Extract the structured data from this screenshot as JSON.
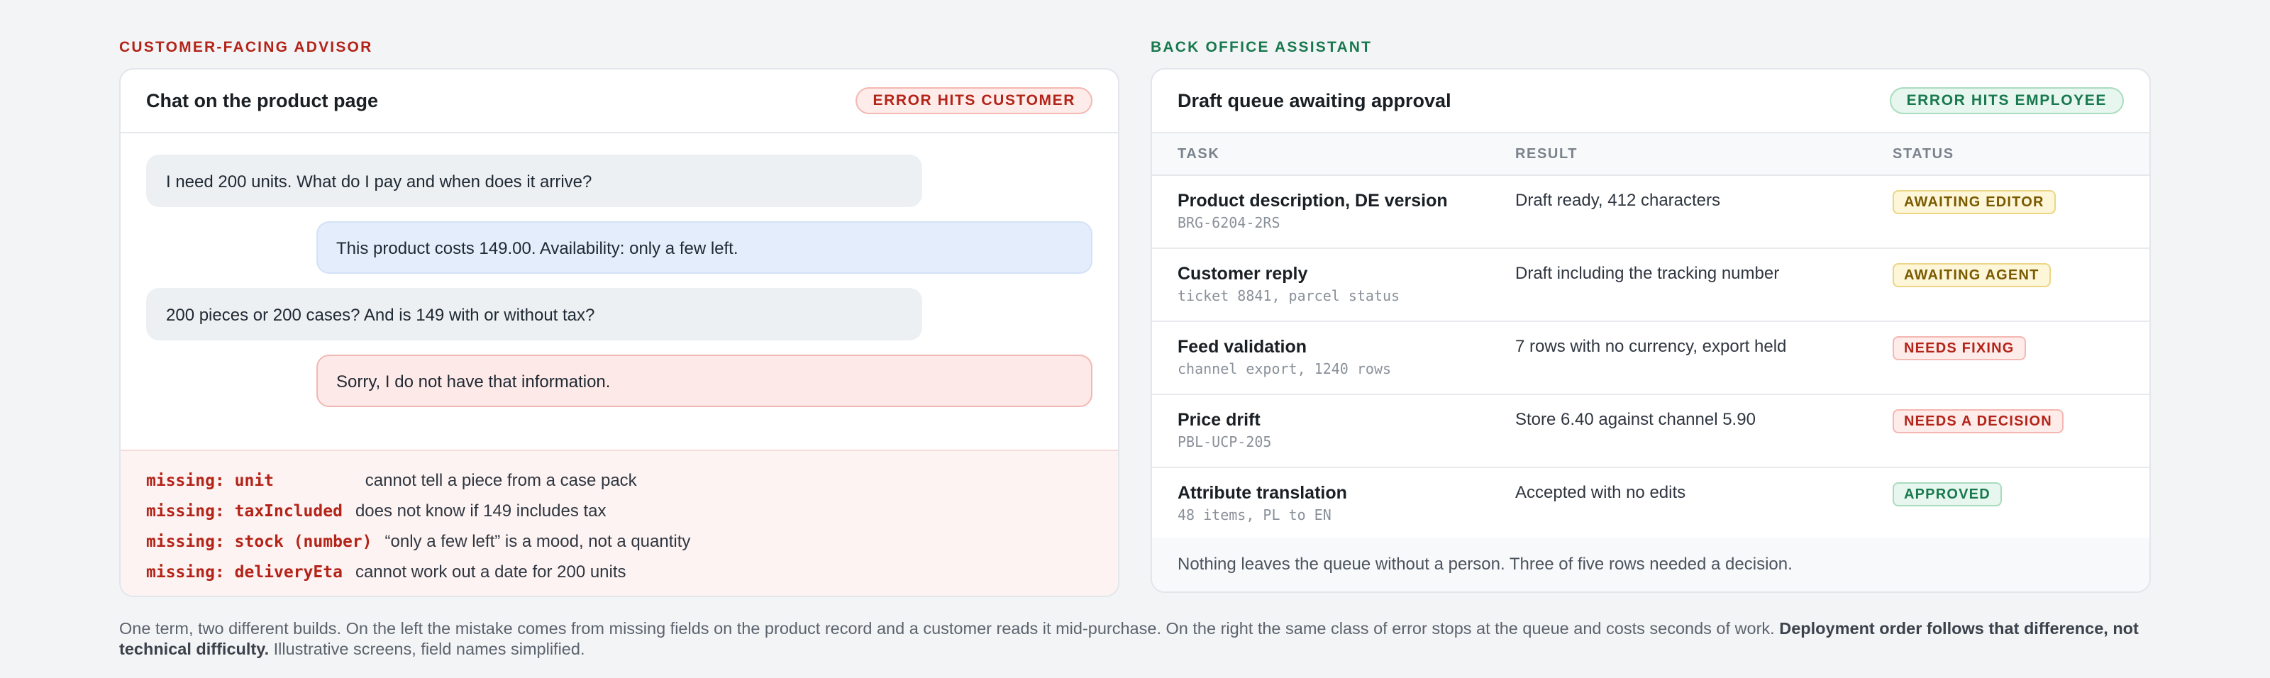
{
  "left": {
    "section_label": "CUSTOMER-FACING ADVISOR",
    "card_title": "Chat on the product page",
    "badge": "ERROR HITS CUSTOMER",
    "messages": [
      {
        "role": "user",
        "text": "I need 200 units. What do I pay and when does it arrive?"
      },
      {
        "role": "bot",
        "text": "This product costs 149.00. Availability: only a few left."
      },
      {
        "role": "user",
        "text": "200 pieces or 200 cases? And is 149 with or without tax?"
      },
      {
        "role": "bot-error",
        "text": "Sorry, I do not have that information."
      }
    ],
    "missing": [
      {
        "key": "missing: unit        ",
        "desc": "cannot tell a piece from a case pack"
      },
      {
        "key": "missing: taxIncluded",
        "desc": "does not know if 149 includes tax"
      },
      {
        "key": "missing: stock (number)",
        "desc": "“only a few left” is a mood, not a quantity"
      },
      {
        "key": "missing: deliveryEta",
        "desc": "cannot work out a date for 200 units"
      }
    ]
  },
  "right": {
    "section_label": "BACK OFFICE ASSISTANT",
    "card_title": "Draft queue awaiting approval",
    "badge": "ERROR HITS EMPLOYEE",
    "columns": [
      "TASK",
      "RESULT",
      "STATUS"
    ],
    "rows": [
      {
        "task": "Product description, DE version",
        "sub": "BRG-6204-2RS",
        "result": "Draft ready, 412 characters",
        "status": "AWAITING EDITOR",
        "tone": "yellow"
      },
      {
        "task": "Customer reply",
        "sub": "ticket 8841, parcel status",
        "result": "Draft including the tracking number",
        "status": "AWAITING AGENT",
        "tone": "yellow"
      },
      {
        "task": "Feed validation",
        "sub": "channel export, 1240 rows",
        "result": "7 rows with no currency, export held",
        "status": "NEEDS FIXING",
        "tone": "red"
      },
      {
        "task": "Price drift",
        "sub": "PBL-UCP-205",
        "result": "Store 6.40 against channel 5.90",
        "status": "NEEDS A DECISION",
        "tone": "red"
      },
      {
        "task": "Attribute translation",
        "sub": "48 items, PL to EN",
        "result": "Accepted with no edits",
        "status": "APPROVED",
        "tone": "green"
      }
    ],
    "footer": "Nothing leaves the queue without a person. Three of five rows needed a decision."
  },
  "caption": {
    "text": "One term, two different builds. On the left the mistake comes from missing fields on the product record and a customer reads it mid-purchase. On the right the same class of error stops at the queue and costs seconds of work. ",
    "bold": "Deployment order follows that difference, not technical difficulty.",
    "tail": " Illustrative screens, field names simplified."
  }
}
